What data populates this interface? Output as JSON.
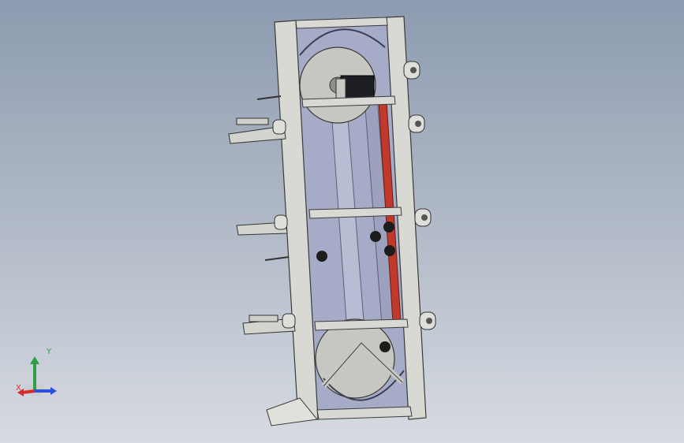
{
  "viewport": {
    "background_top": "#8d9bb0",
    "background_bottom": "#d7dbe2"
  },
  "model": {
    "frame_color": "#d9d9d4",
    "panel_color": "#a6acc8",
    "belt_color": "#c0392b"
  },
  "triad": {
    "x_label": "X",
    "y_label": "Y",
    "x_color": "#d92b2b",
    "y_color": "#2ea043",
    "z_color": "#2b4fd9"
  }
}
